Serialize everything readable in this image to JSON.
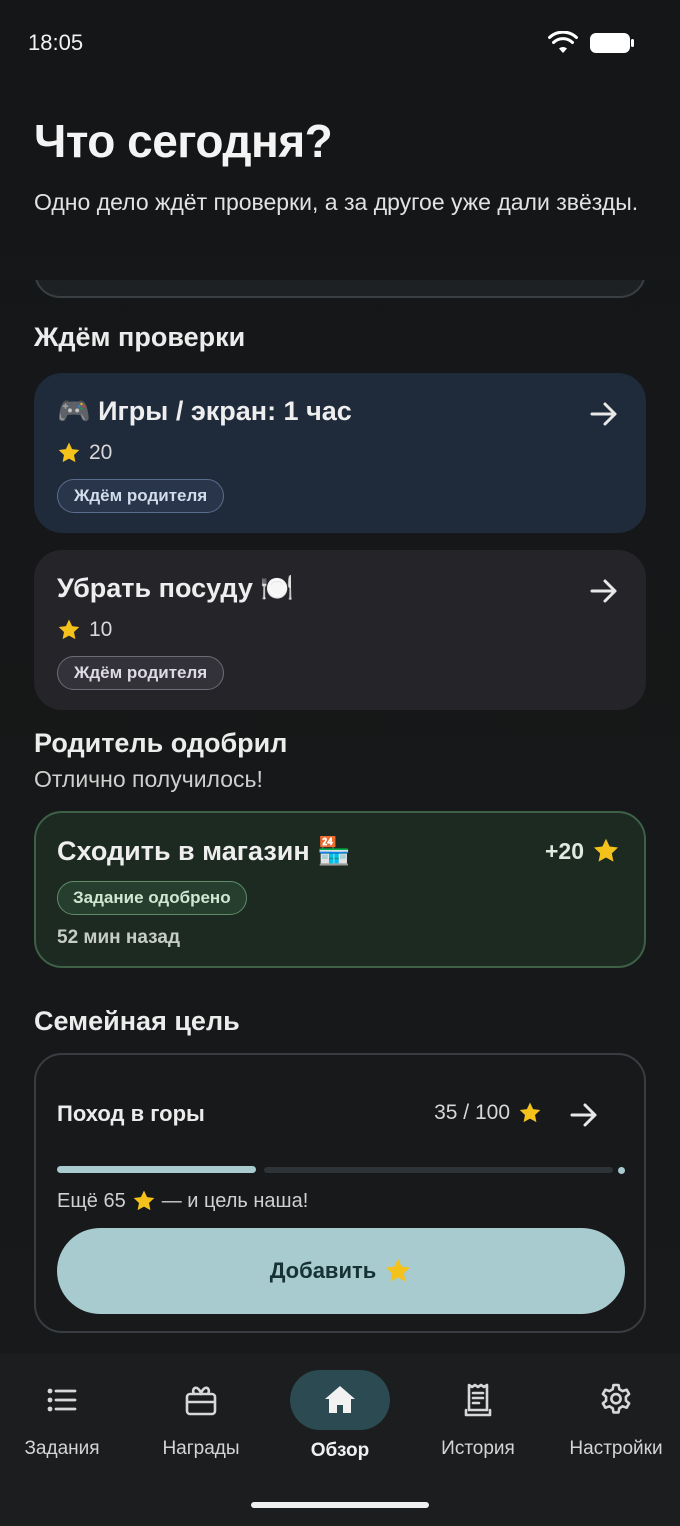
{
  "status_bar": {
    "time": "18:05"
  },
  "header": {
    "title": "Что сегодня?",
    "subtitle": "Одно дело ждёт проверки, а за другое уже дали звёзды."
  },
  "pending": {
    "section_title": "Ждём проверки",
    "tasks": [
      {
        "title": "🎮 Игры / экран: 1 час",
        "points": "20",
        "badge": "Ждём родителя"
      },
      {
        "title": "Убрать посуду 🍽️",
        "points": "10",
        "badge": "Ждём родителя"
      }
    ]
  },
  "approved": {
    "section_title": "Родитель одобрил",
    "section_subtitle": "Отлично получилось!",
    "task": {
      "title": "Сходить в магазин 🏪",
      "reward": "+20",
      "badge": "Задание одобрено",
      "time": "52 мин назад"
    }
  },
  "goal": {
    "section_title": "Семейная цель",
    "name": "Поход в горы",
    "progress_text": "35 / 100",
    "current": 35,
    "target": 100,
    "remaining_prefix": "Ещё 65",
    "remaining_suffix": "— и цель наша!",
    "add_label": "Добавить"
  },
  "nav": {
    "items": [
      {
        "label": "Задания",
        "icon": "list-icon"
      },
      {
        "label": "Награды",
        "icon": "gift-icon"
      },
      {
        "label": "Обзор",
        "icon": "home-icon",
        "active": true
      },
      {
        "label": "История",
        "icon": "receipt-icon"
      },
      {
        "label": "Настройки",
        "icon": "gear-icon"
      }
    ]
  },
  "colors": {
    "background": "#141617",
    "pending_blue": "#1f2a3a",
    "pending_gray": "#252429",
    "approved_green": "#1d2a22",
    "accent": "#a8cbcf",
    "nav_active": "#2b4a52"
  }
}
